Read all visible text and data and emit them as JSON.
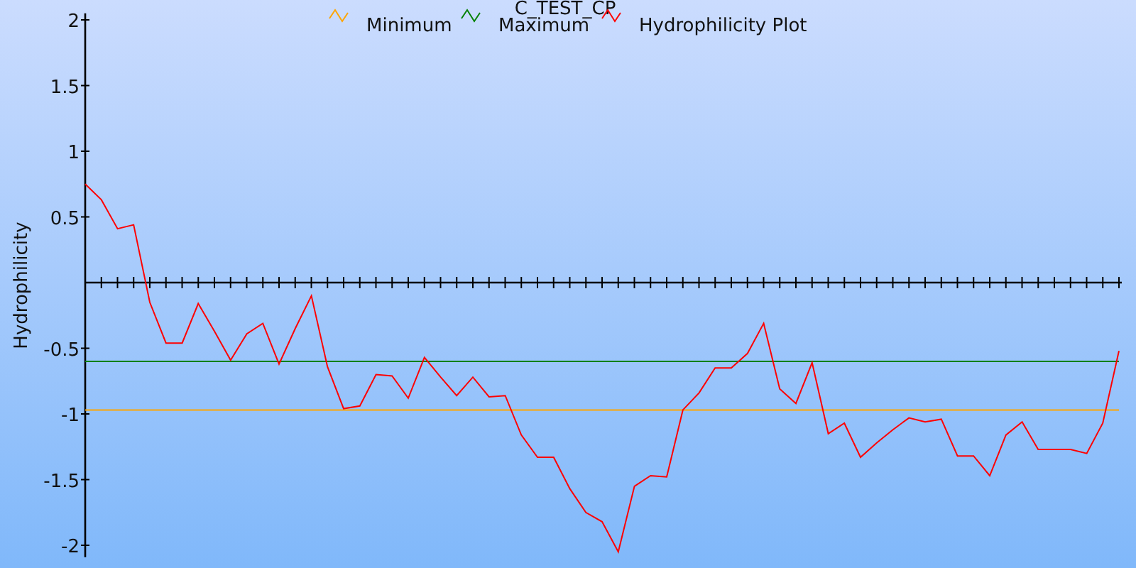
{
  "chart_data": {
    "type": "line",
    "title": "C_TEST_CP",
    "ylabel": "Hydrophilicity",
    "ylim": [
      -2.09,
      2.05
    ],
    "legend": true,
    "yticks": [
      -2,
      -1.5,
      -1,
      -0.5,
      0.5,
      1,
      1.5,
      2
    ],
    "series": [
      {
        "name": "Minimum",
        "color": "#ffa500",
        "values": [
          -0.97,
          -0.97,
          -0.97,
          -0.97,
          -0.97,
          -0.97,
          -0.97,
          -0.97,
          -0.97,
          -0.97,
          -0.97,
          -0.97,
          -0.97,
          -0.97,
          -0.97,
          -0.97,
          -0.97,
          -0.97,
          -0.97,
          -0.97,
          -0.97,
          -0.97,
          -0.97,
          -0.97,
          -0.97,
          -0.97,
          -0.97,
          -0.97,
          -0.97,
          -0.97,
          -0.97,
          -0.97,
          -0.97,
          -0.97,
          -0.97,
          -0.97,
          -0.97,
          -0.97,
          -0.97,
          -0.97,
          -0.97,
          -0.97,
          -0.97,
          -0.97,
          -0.97,
          -0.97,
          -0.97,
          -0.97,
          -0.97,
          -0.97,
          -0.97,
          -0.97,
          -0.97,
          -0.97,
          -0.97,
          -0.97,
          -0.97,
          -0.97,
          -0.97,
          -0.97,
          -0.97,
          -0.97,
          -0.97,
          -0.97,
          -0.97
        ]
      },
      {
        "name": "Maximum",
        "color": "#008000",
        "values": [
          -0.6,
          -0.6,
          -0.6,
          -0.6,
          -0.6,
          -0.6,
          -0.6,
          -0.6,
          -0.6,
          -0.6,
          -0.6,
          -0.6,
          -0.6,
          -0.6,
          -0.6,
          -0.6,
          -0.6,
          -0.6,
          -0.6,
          -0.6,
          -0.6,
          -0.6,
          -0.6,
          -0.6,
          -0.6,
          -0.6,
          -0.6,
          -0.6,
          -0.6,
          -0.6,
          -0.6,
          -0.6,
          -0.6,
          -0.6,
          -0.6,
          -0.6,
          -0.6,
          -0.6,
          -0.6,
          -0.6,
          -0.6,
          -0.6,
          -0.6,
          -0.6,
          -0.6,
          -0.6,
          -0.6,
          -0.6,
          -0.6,
          -0.6,
          -0.6,
          -0.6,
          -0.6,
          -0.6,
          -0.6,
          -0.6,
          -0.6,
          -0.6,
          -0.6,
          -0.6,
          -0.6,
          -0.6,
          -0.6,
          -0.6,
          -0.6
        ]
      },
      {
        "name": "Hydrophilicity Plot",
        "color": "#ff0000",
        "values": [
          0.75,
          0.63,
          0.41,
          0.44,
          -0.15,
          -0.46,
          -0.46,
          -0.16,
          -0.37,
          -0.59,
          -0.39,
          -0.31,
          -0.62,
          -0.35,
          -0.1,
          -0.64,
          -0.96,
          -0.94,
          -0.7,
          -0.71,
          -0.88,
          -0.57,
          -0.72,
          -0.86,
          -0.72,
          -0.87,
          -0.86,
          -1.16,
          -1.33,
          -1.33,
          -1.57,
          -1.75,
          -1.82,
          -2.05,
          -1.55,
          -1.47,
          -1.48,
          -0.97,
          -0.84,
          -0.65,
          -0.65,
          -0.54,
          -0.31,
          -0.81,
          -0.92,
          -0.61,
          -1.15,
          -1.07,
          -1.33,
          -1.22,
          -1.12,
          -1.03,
          -1.06,
          -1.04,
          -1.32,
          -1.32,
          -1.47,
          -1.16,
          -1.06,
          -1.27,
          -1.27,
          -1.27,
          -1.3,
          -1.07,
          -0.52
        ]
      }
    ]
  }
}
